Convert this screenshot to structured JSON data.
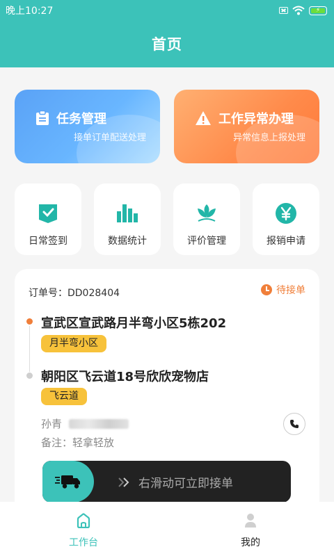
{
  "status_bar": {
    "time": "晚上10:27"
  },
  "header": {
    "title": "首页"
  },
  "big_cards": [
    {
      "title": "任务管理",
      "subtitle": "接单订单配送处理",
      "icon": "clipboard-icon"
    },
    {
      "title": "工作异常办理",
      "subtitle": "异常信息上报处理",
      "icon": "warning-icon"
    }
  ],
  "shortcuts": [
    {
      "label": "日常签到",
      "icon": "checkin-icon"
    },
    {
      "label": "数据统计",
      "icon": "bar-chart-icon"
    },
    {
      "label": "评价管理",
      "icon": "lotus-icon"
    },
    {
      "label": "报销申请",
      "icon": "yen-icon"
    }
  ],
  "order": {
    "number": "订单号：DD028404",
    "status": "待接单",
    "pickup_address": "宣武区宣武路月半弯小区5栋202",
    "pickup_tag": "月半弯小区",
    "delivery_address": "朝阳区飞云道18号欣欣宠物店",
    "delivery_tag": "飞云道",
    "customer_name": "孙青",
    "note": "备注：轻拿轻放",
    "slider_hint": "右滑动可立即接单"
  },
  "tabs": [
    {
      "label": "工作台",
      "icon": "home-icon",
      "active": true
    },
    {
      "label": "我的",
      "icon": "user-icon",
      "active": false
    }
  ],
  "colors": {
    "primary": "#3cc2b9",
    "accent_orange": "#f07f3a",
    "tag_yellow": "#f7c23b"
  }
}
